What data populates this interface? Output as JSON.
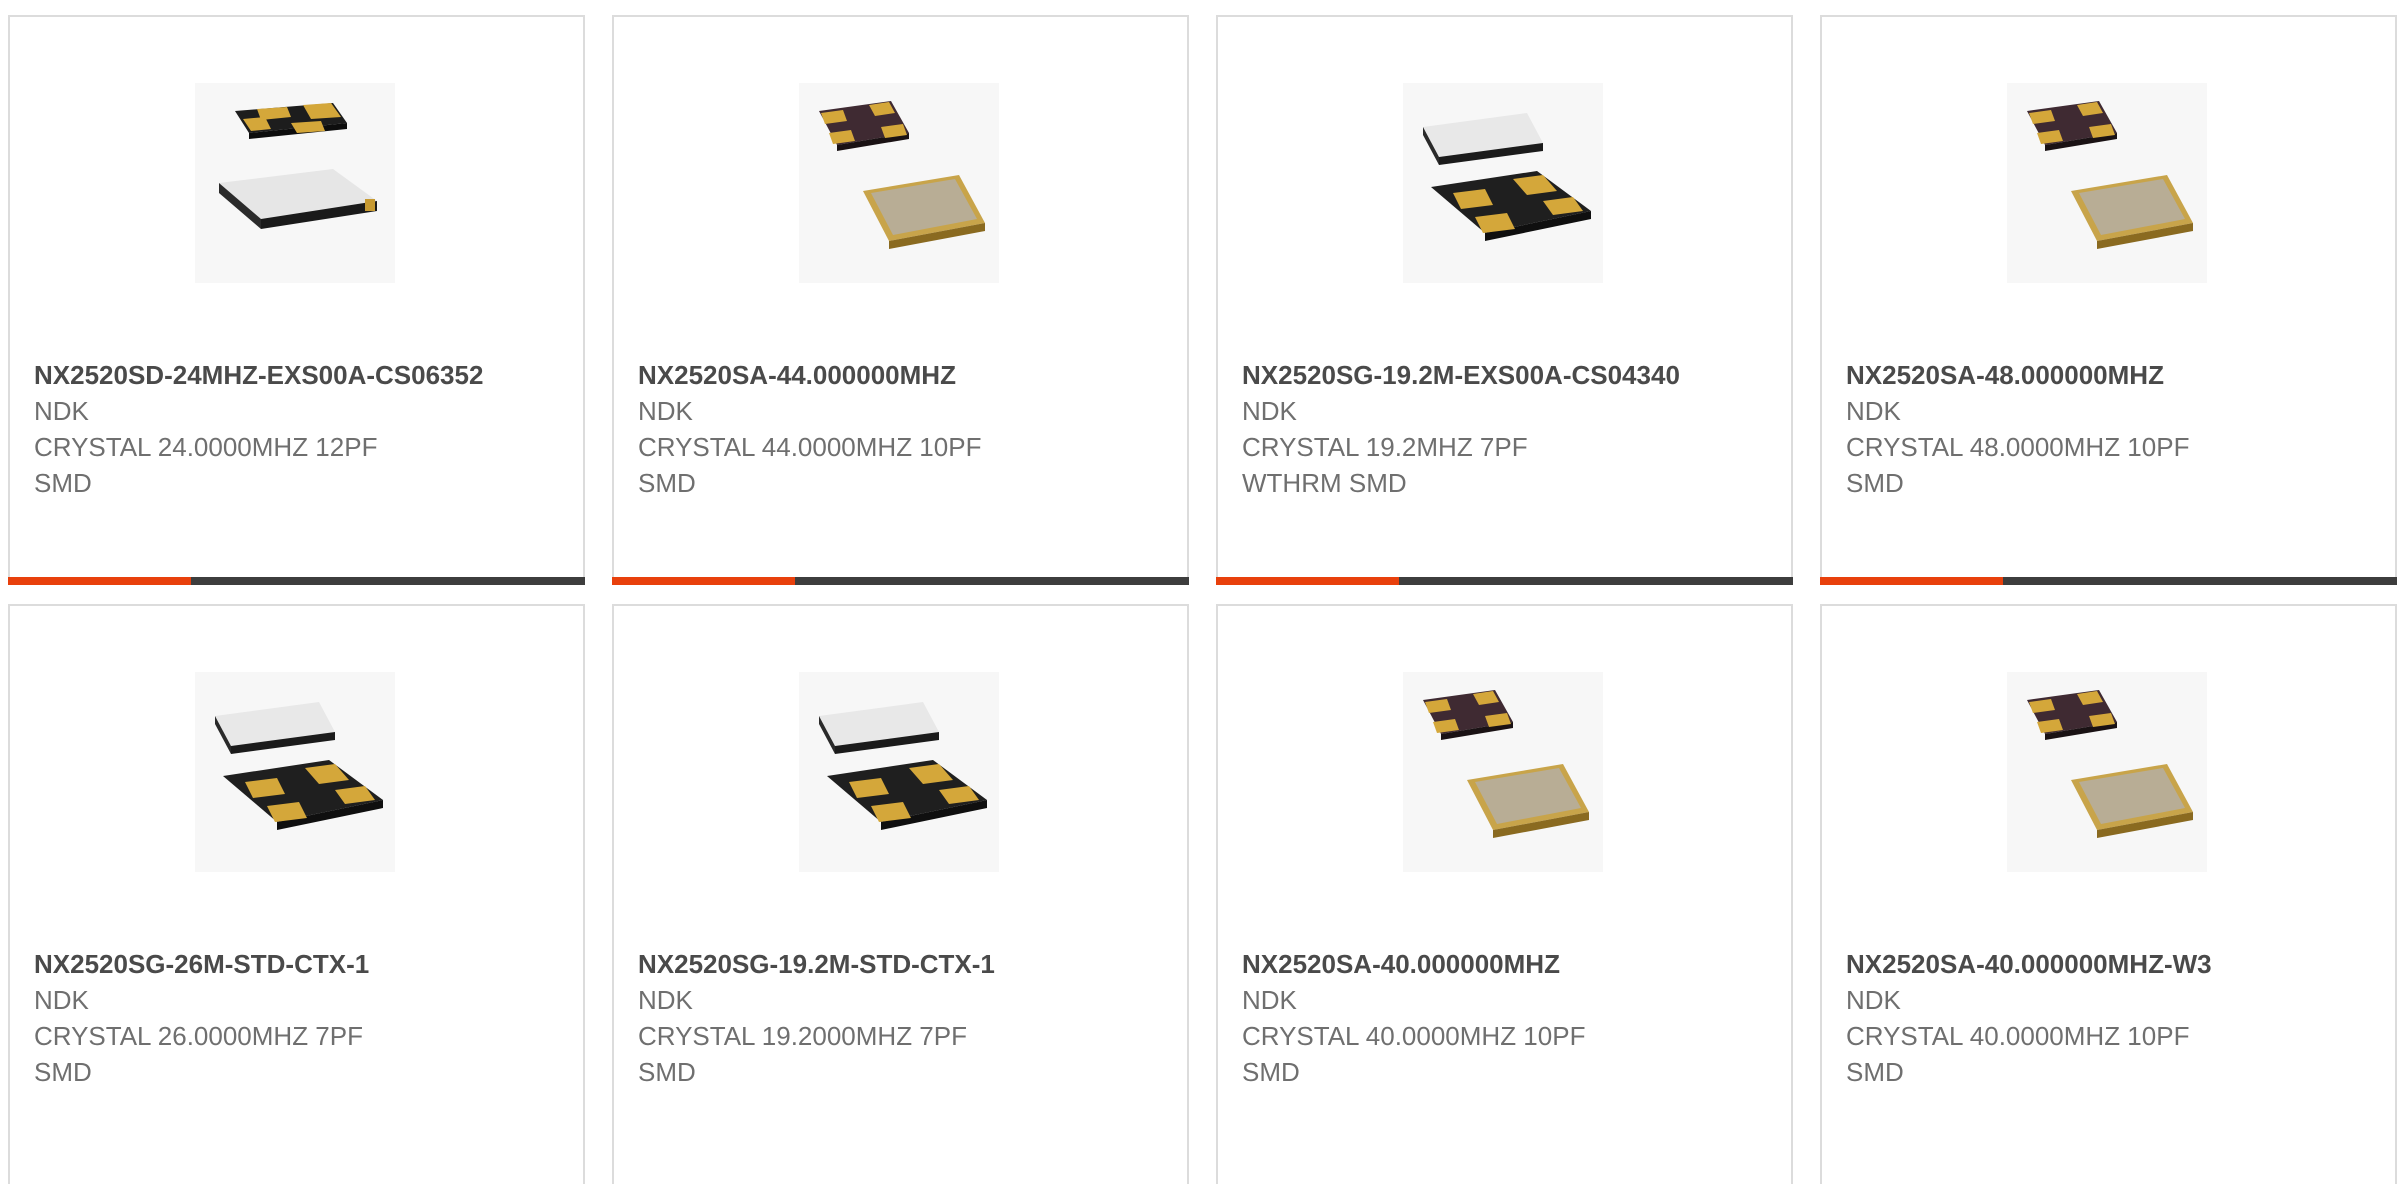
{
  "colors": {
    "accent": "#e8400c",
    "bar_dark": "#3d3d3d",
    "border": "#dcdcdc"
  },
  "products": [
    {
      "part": "NX2520SD-24MHZ-EXS00A-CS06352",
      "maker": "NDK",
      "desc1": "CRYSTAL 24.0000MHZ 12PF",
      "desc2": "SMD",
      "image": "crystal-silver-lid-top-icon"
    },
    {
      "part": "NX2520SA-44.000000MHZ",
      "maker": "NDK",
      "desc1": "CRYSTAL 44.0000MHZ 10PF",
      "desc2": "SMD",
      "image": "crystal-gold-lid-icon"
    },
    {
      "part": "NX2520SG-19.2M-EXS00A-CS04340",
      "maker": "NDK",
      "desc1": "CRYSTAL 19.2MHZ 7PF",
      "desc2": "WTHRM SMD",
      "image": "crystal-silver-lid-bottom-icon"
    },
    {
      "part": "NX2520SA-48.000000MHZ",
      "maker": "NDK",
      "desc1": "CRYSTAL 48.0000MHZ 10PF",
      "desc2": "SMD",
      "image": "crystal-gold-lid-icon"
    },
    {
      "part": "NX2520SG-26M-STD-CTX-1",
      "maker": "NDK",
      "desc1": "CRYSTAL 26.0000MHZ 7PF",
      "desc2": "SMD",
      "image": "crystal-silver-lid-bottom-icon"
    },
    {
      "part": "NX2520SG-19.2M-STD-CTX-1",
      "maker": "NDK",
      "desc1": "CRYSTAL 19.2000MHZ 7PF",
      "desc2": "SMD",
      "image": "crystal-silver-lid-bottom-icon"
    },
    {
      "part": "NX2520SA-40.000000MHZ",
      "maker": "NDK",
      "desc1": "CRYSTAL 40.0000MHZ 10PF",
      "desc2": "SMD",
      "image": "crystal-gold-lid-icon"
    },
    {
      "part": "NX2520SA-40.000000MHZ-W3",
      "maker": "NDK",
      "desc1": "CRYSTAL 40.0000MHZ 10PF",
      "desc2": "SMD",
      "image": "crystal-gold-lid-icon"
    }
  ]
}
